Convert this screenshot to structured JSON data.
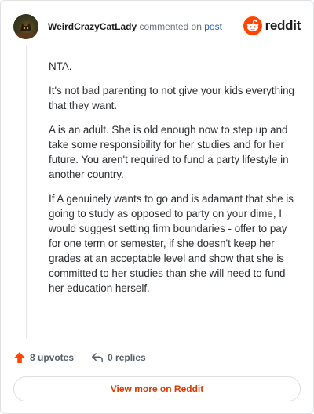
{
  "comment": {
    "username": "WeirdCrazyCatLady",
    "commented_on": "commented on",
    "post_link": "post",
    "paragraphs": [
      "NTA.",
      "It's not bad parenting to not give your kids everything that they want.",
      "A is an adult. She is old enough now to step up and take some responsibility for her studies and for her future. You aren't required to fund a party lifestyle in another country.",
      "If A genuinely wants to go and is adamant that she is going to study as opposed to party on your dime, I would suggest setting firm boundaries - offer to pay for one term or semester, if she doesn't keep her grades at an acceptable level and show that she is committed to her studies than she will need to fund her education herself."
    ]
  },
  "brand": {
    "logo_text": "reddit",
    "accent": "#ff4500"
  },
  "actions": {
    "upvotes": "8 upvotes",
    "replies": "0 replies"
  },
  "footer": {
    "view_more": "View more on Reddit"
  },
  "icons": {
    "avatar": "cat-avatar",
    "logo": "reddit-snoo-icon",
    "upvote": "upvote-arrow-icon",
    "reply": "reply-arrow-icon"
  }
}
